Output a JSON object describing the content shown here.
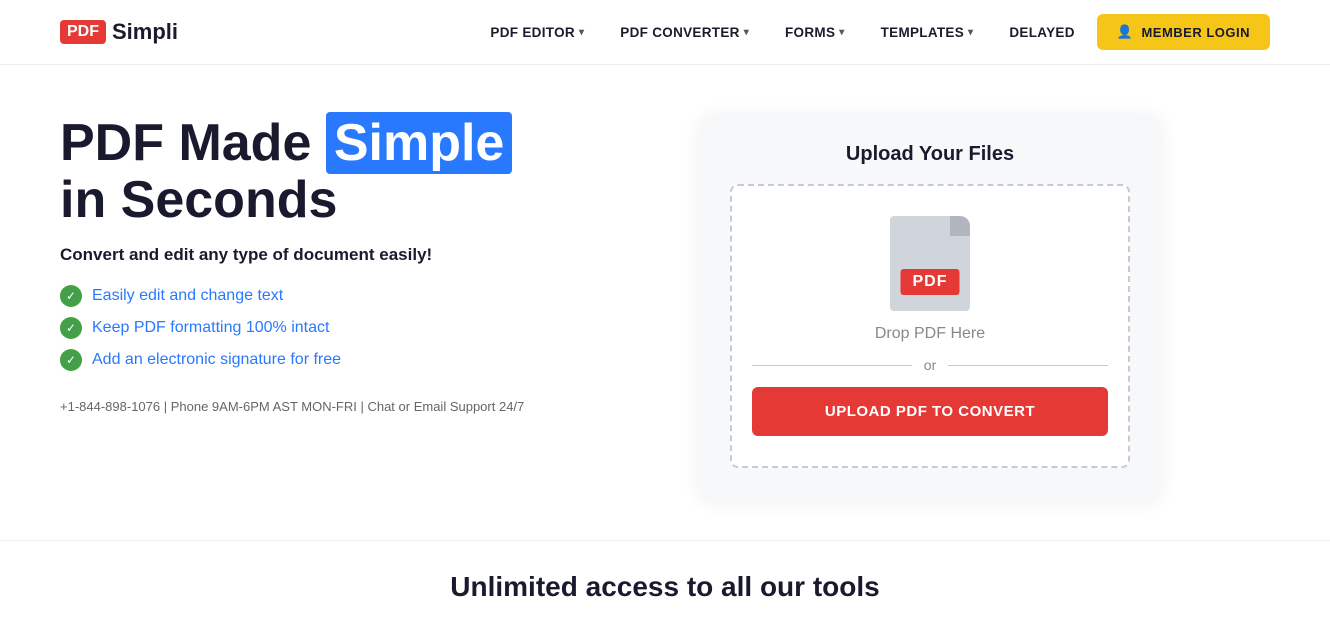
{
  "logo": {
    "pdf": "PDF",
    "simpli": "Simpli"
  },
  "nav": {
    "items": [
      {
        "label": "PDF EDITOR",
        "hasChevron": true
      },
      {
        "label": "PDF CONVERTER",
        "hasChevron": true
      },
      {
        "label": "FORMS",
        "hasChevron": true
      },
      {
        "label": "TEMPLATES",
        "hasChevron": true
      },
      {
        "label": "DELAYED",
        "hasChevron": false
      }
    ],
    "login_label": "MEMBER LOGIN"
  },
  "hero": {
    "title_part1": "PDF Made ",
    "title_highlight": "Simple",
    "title_part2": "in Seconds",
    "subtitle": "Convert and edit any type of document easily!",
    "features": [
      "Easily edit and change text",
      "Keep PDF formatting 100% intact",
      "Add an electronic signature for free"
    ],
    "contact": "+1-844-898-1076 | Phone 9AM-6PM AST MON-FRI | Chat or Email Support 24/7"
  },
  "upload": {
    "title": "Upload Your Files",
    "drop_text": "Drop PDF Here",
    "or_text": "or",
    "pdf_label": "PDF",
    "upload_button": "UPLOAD PDF TO CONVERT"
  },
  "bottom": {
    "title": "Unlimited access to all our tools"
  }
}
